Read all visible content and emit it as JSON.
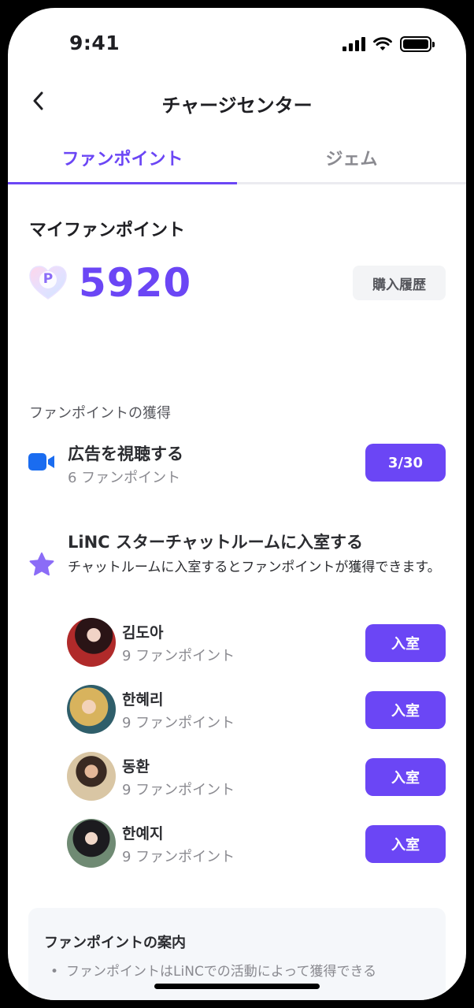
{
  "status_bar": {
    "time": "9:41"
  },
  "header": {
    "title": "チャージセンター"
  },
  "tabs": [
    {
      "label": "ファンポイント",
      "active": true
    },
    {
      "label": "ジェム",
      "active": false
    }
  ],
  "my_points": {
    "title": "マイファンポイント",
    "badge": "P",
    "value": "5920",
    "history_label": "購入履歴"
  },
  "earning": {
    "label": "ファンポイントの獲得",
    "ad": {
      "icon": "video-camera-icon",
      "title": "広告を視聴する",
      "subtitle": "6 ファンポイント",
      "button": "3/30"
    },
    "star_chat": {
      "icon": "star-icon",
      "title": "LiNC スターチャットルームに入室する",
      "description": "チャットルームに入室するとファンポイントが獲得できます。"
    },
    "rooms": [
      {
        "name": "김도아",
        "points": "9 ファンポイント",
        "button": "入室"
      },
      {
        "name": "한혜리",
        "points": "9 ファンポイント",
        "button": "入室"
      },
      {
        "name": "동환",
        "points": "9 ファンポイント",
        "button": "入室"
      },
      {
        "name": "한예지",
        "points": "9 ファンポイント",
        "button": "入室"
      }
    ]
  },
  "guide": {
    "title": "ファンポイントの案内",
    "items": [
      "ファンポイントはLiNCでの活動によって獲得できる"
    ]
  },
  "colors": {
    "accent": "#6b46f5",
    "video_icon": "#1a6cf0",
    "star_icon": "#8b6cf7"
  }
}
